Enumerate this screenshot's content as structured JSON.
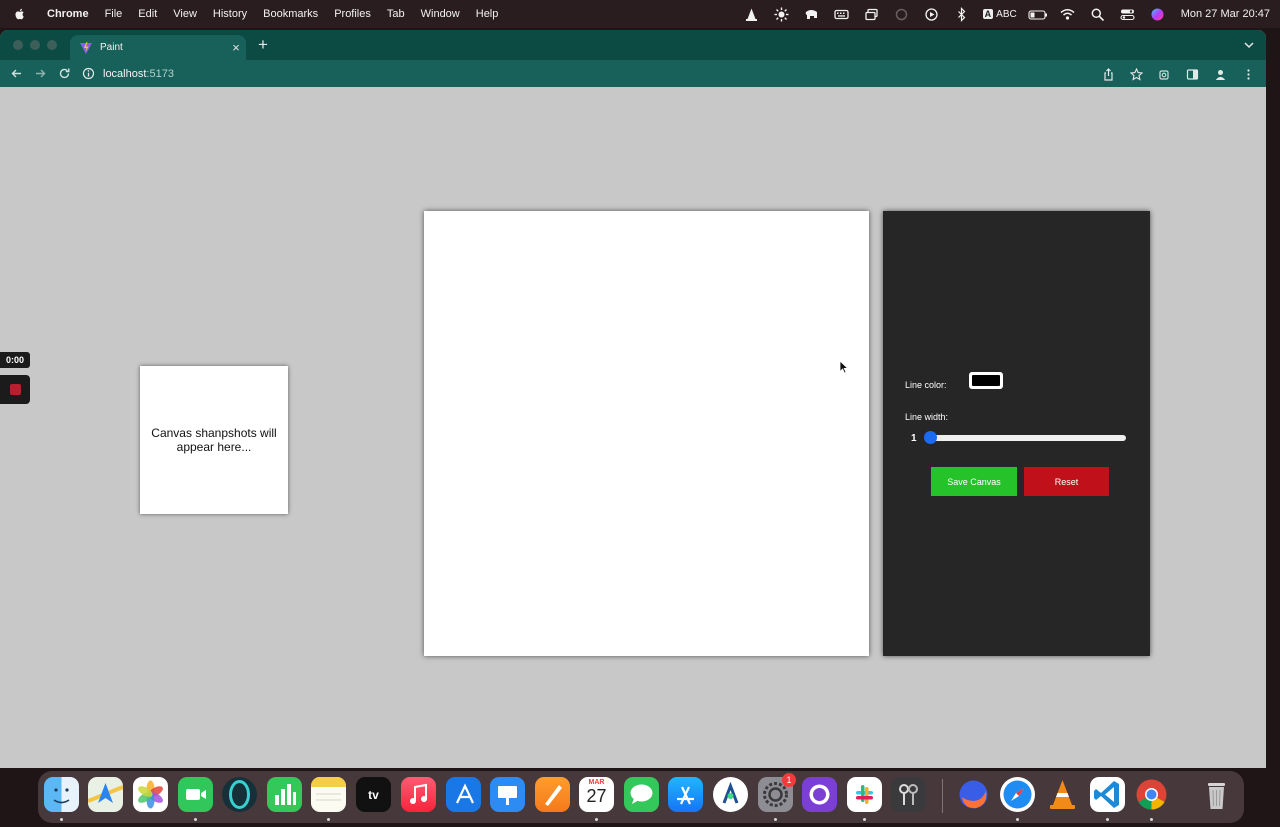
{
  "menubar": {
    "app_name": "Chrome",
    "menus": [
      "File",
      "Edit",
      "View",
      "History",
      "Bookmarks",
      "Profiles",
      "Tab",
      "Window",
      "Help"
    ],
    "input_source": "ABC",
    "clock": "Mon 27 Mar  20:47"
  },
  "browser": {
    "tab_title": "Paint",
    "url_host": "localhost",
    "url_port": ":5173"
  },
  "page": {
    "snapshot_placeholder": "Canvas shanpshots will appear here...",
    "line_color_label": "Line color:",
    "line_color_value": "#000000",
    "line_width_label": "Line width:",
    "line_width_value": "1",
    "save_button": "Save Canvas",
    "reset_button": "Reset"
  },
  "recorder": {
    "time": "0:00"
  },
  "dock": {
    "calendar_month": "MAR",
    "calendar_day": "27",
    "settings_badge": "1",
    "apps": [
      "finder",
      "maps",
      "photos",
      "facetime",
      "cortana",
      "numbers",
      "notes",
      "apple-tv",
      "music",
      "xcode",
      "keynote",
      "pages",
      "calendar",
      "messages",
      "app-store",
      "android-studio",
      "system-settings",
      "github-desktop",
      "slack",
      "keychain",
      "firefox",
      "safari",
      "vlc",
      "vscode",
      "chrome",
      "trash"
    ]
  },
  "colors": {
    "tab_bar": "#0c4a44",
    "toolbar": "#17615a",
    "page_background": "#c8c8c8",
    "controls_panel": "#262626",
    "save_button": "#26c22a",
    "reset_button": "#c0111a",
    "slider_thumb": "#1a6bf0"
  }
}
